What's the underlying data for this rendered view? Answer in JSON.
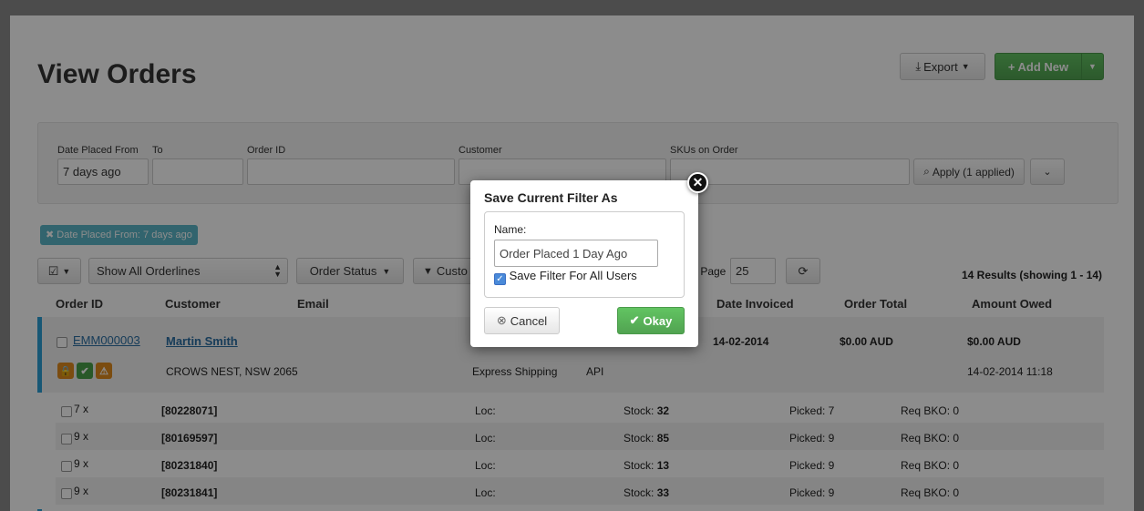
{
  "page": {
    "title": "View Orders",
    "export_label": "Export",
    "add_new_label": "Add New"
  },
  "filters": {
    "date_from_label": "Date Placed From",
    "date_from_value": "7 days ago",
    "to_label": "To",
    "order_id_label": "Order ID",
    "customer_label": "Customer",
    "skus_label": "SKUs on Order",
    "apply_label": "Apply (1 applied)"
  },
  "active_chip": "Date Placed From: 7 days ago",
  "toolbar": {
    "orderlines_select": "Show All Orderlines",
    "order_status": "Order Status",
    "customer_filter": "Custo",
    "per_page_label": "r Page",
    "per_page_value": "25",
    "results": "14 Results (showing 1 - 14)"
  },
  "table": {
    "headers": {
      "order_id": "Order ID",
      "customer": "Customer",
      "email": "Email",
      "date_invoiced": "Date Invoiced",
      "order_total": "Order Total",
      "amount_owed": "Amount Owed"
    },
    "order": {
      "id": "EMM000003",
      "customer": "Martin Smith",
      "date_invoiced": "14-02-2014",
      "order_total": "$0.00 AUD",
      "amount_owed": "$0.00 AUD",
      "address": "CROWS NEST, NSW 2065",
      "shipping": "Express Shipping",
      "source": "API",
      "date_placed": "14-02-2014 11:18"
    },
    "lines": [
      {
        "qty": "7 x",
        "sku": "[80228071]",
        "loc": "Loc:",
        "stock_label": "Stock:",
        "stock": "32",
        "picked": "Picked: 7",
        "bko": "Req BKO: 0"
      },
      {
        "qty": "9 x",
        "sku": "[80169597]",
        "loc": "Loc:",
        "stock_label": "Stock:",
        "stock": "85",
        "picked": "Picked: 9",
        "bko": "Req BKO: 0"
      },
      {
        "qty": "9 x",
        "sku": "[80231840]",
        "loc": "Loc:",
        "stock_label": "Stock:",
        "stock": "13",
        "picked": "Picked: 9",
        "bko": "Req BKO: 0"
      },
      {
        "qty": "9 x",
        "sku": "[80231841]",
        "loc": "Loc:",
        "stock_label": "Stock:",
        "stock": "33",
        "picked": "Picked: 9",
        "bko": "Req BKO: 0"
      }
    ]
  },
  "modal": {
    "title": "Save Current Filter As",
    "name_label": "Name:",
    "name_value": "Order Placed 1 Day Ago",
    "save_all_label": "Save Filter For All Users",
    "cancel_label": "Cancel",
    "okay_label": "Okay"
  },
  "colors": {
    "accent_green": "#5cb85c",
    "chip_teal": "#5bb7c8",
    "order_bar": "#2a9fd6"
  }
}
